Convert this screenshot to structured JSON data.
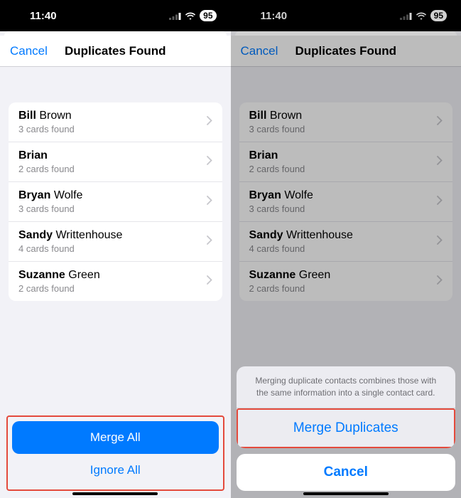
{
  "statusbar": {
    "time": "11:40",
    "battery": "95"
  },
  "nav": {
    "cancel": "Cancel",
    "title": "Duplicates Found"
  },
  "contacts": [
    {
      "first": "Bill",
      "last": "Brown",
      "sub": "3 cards found"
    },
    {
      "first": "Brian",
      "last": "",
      "sub": "2 cards found"
    },
    {
      "first": "Bryan",
      "last": "Wolfe",
      "sub": "3 cards found"
    },
    {
      "first": "Sandy",
      "last": "Writtenhouse",
      "sub": "4 cards found"
    },
    {
      "first": "Suzanne",
      "last": "Green",
      "sub": "2 cards found"
    }
  ],
  "footer": {
    "merge_all": "Merge All",
    "ignore_all": "Ignore All"
  },
  "sheet": {
    "message": "Merging duplicate contacts combines those with the same information into a single contact card.",
    "merge": "Merge Duplicates",
    "cancel": "Cancel"
  }
}
